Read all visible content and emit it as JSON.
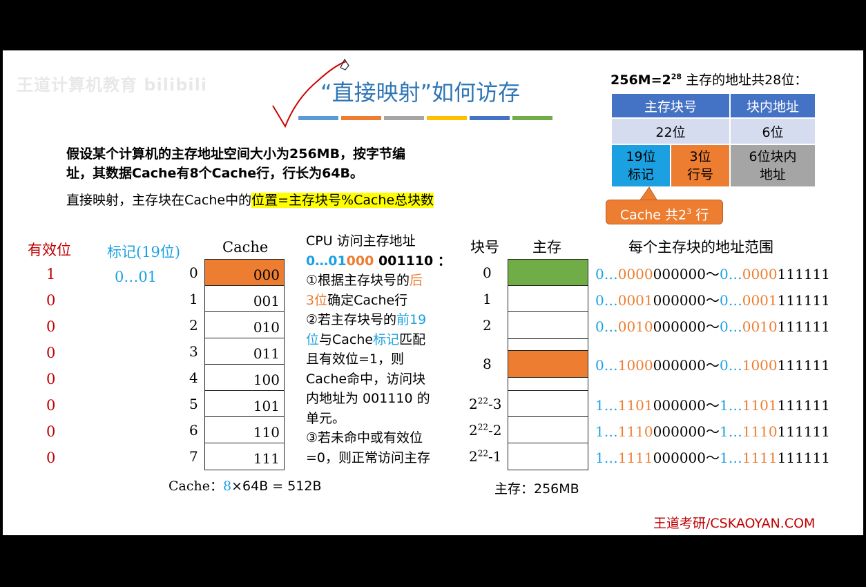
{
  "watermark": "王道计算机教育 bilibili",
  "title": "“直接映射”如何访存",
  "title_bar_colors": [
    "#5b9bd5",
    "#ed7d31",
    "#a5a5a5",
    "#ffc000",
    "#4472c4",
    "#70ad47"
  ],
  "intro": {
    "line1": "假设某个计算机的主存地址空间大小为256MB，按字节编",
    "line2": "址，其数据Cache有8个Cache行，行长为64B。",
    "line3_pre": "直接映射，主存块在Cache中的",
    "line3_hl": "位置=主存块号%Cache总块数"
  },
  "addr_table": {
    "caption_pre": "256M=2",
    "caption_sup": "28",
    "caption_post": " 主存的地址共28位：",
    "h_block": "主存块号",
    "h_offset": "块内地址",
    "r2_block": "22位",
    "r2_offset": "6位",
    "r3_tag_a": "19位",
    "r3_tag_b": "标记",
    "r3_line_a": "3位",
    "r3_line_b": "行号",
    "r3_off_a": "6位块内",
    "r3_off_b": "地址",
    "callout_pre": "Cache 共2",
    "callout_sup": "3",
    "callout_post": " 行"
  },
  "cache": {
    "valid_header": "有效位",
    "tag_header": "标记(19位)",
    "cache_header": "Cache",
    "valid_bits": [
      "1",
      "0",
      "0",
      "0",
      "0",
      "0",
      "0",
      "0"
    ],
    "tag_first": "0…01",
    "indices": [
      "0",
      "1",
      "2",
      "3",
      "4",
      "5",
      "6",
      "7"
    ],
    "lines": [
      "000",
      "001",
      "010",
      "011",
      "100",
      "101",
      "110",
      "111"
    ],
    "size_label": "Cache：",
    "size_8": "8",
    "size_rest": "×64B = 512B"
  },
  "steps": {
    "l1": "CPU 访问主存地址",
    "l2_a": "0…01",
    "l2_b": "000",
    "l2_c": " 001110 ：",
    "l3_a": "①根据主存块号的",
    "l3_b": "后",
    "l4_a": "3位",
    "l4_b": "确定Cache行",
    "l5_a": "②若主存块号的",
    "l5_b": "前19",
    "l6_a": "位",
    "l6_b": "与Cache",
    "l6_c": "标记",
    "l6_d": "匹配",
    "l7": "且有效位=1，则",
    "l8": "Cache命中，访问块",
    "l9": "内地址为 001110 的",
    "l10": "单元。",
    "l11": "③若未命中或有效位",
    "l12": "=0，则正常访问主存"
  },
  "memory": {
    "block_header": "块号",
    "mem_header": "主存",
    "range_header": "每个主存块的地址范围",
    "size_label": "主存：256MB",
    "rows": [
      {
        "num": "0",
        "exp": "",
        "color": "#70ad47",
        "s1": "0…",
        "s2": "0000",
        "s3": "000000",
        "e1": "0…",
        "e2": "0000",
        "e3": "111111"
      },
      {
        "num": "1",
        "exp": "",
        "color": "#ffffff",
        "s1": "0…",
        "s2": "0001",
        "s3": "000000",
        "e1": "0…",
        "e2": "0001",
        "e3": "111111"
      },
      {
        "num": "2",
        "exp": "",
        "color": "#ffffff",
        "s1": "0…",
        "s2": "0010",
        "s3": "000000",
        "e1": "0…",
        "e2": "0010",
        "e3": "111111"
      },
      {
        "num": "8",
        "exp": "",
        "color": "#ed7d31",
        "s1": "0…",
        "s2": "1000",
        "s3": "000000",
        "e1": "0…",
        "e2": "1000",
        "e3": "111111"
      },
      {
        "num": "2",
        "exp": "22",
        "suffix": "-3",
        "color": "#ffffff",
        "s1": "1…",
        "s2": "1101",
        "s3": "000000",
        "e1": "1…",
        "e2": "1101",
        "e3": "111111"
      },
      {
        "num": "2",
        "exp": "22",
        "suffix": "-2",
        "color": "#ffffff",
        "s1": "1…",
        "s2": "1110",
        "s3": "000000",
        "e1": "1…",
        "e2": "1110",
        "e3": "111111"
      },
      {
        "num": "2",
        "exp": "22",
        "suffix": "-1",
        "color": "#ffffff",
        "s1": "1…",
        "s2": "1111",
        "s3": "000000",
        "e1": "1…",
        "e2": "1111",
        "e3": "111111"
      }
    ],
    "tilde": "～"
  },
  "footer": "王道考研/CSKAOYAN.COM"
}
